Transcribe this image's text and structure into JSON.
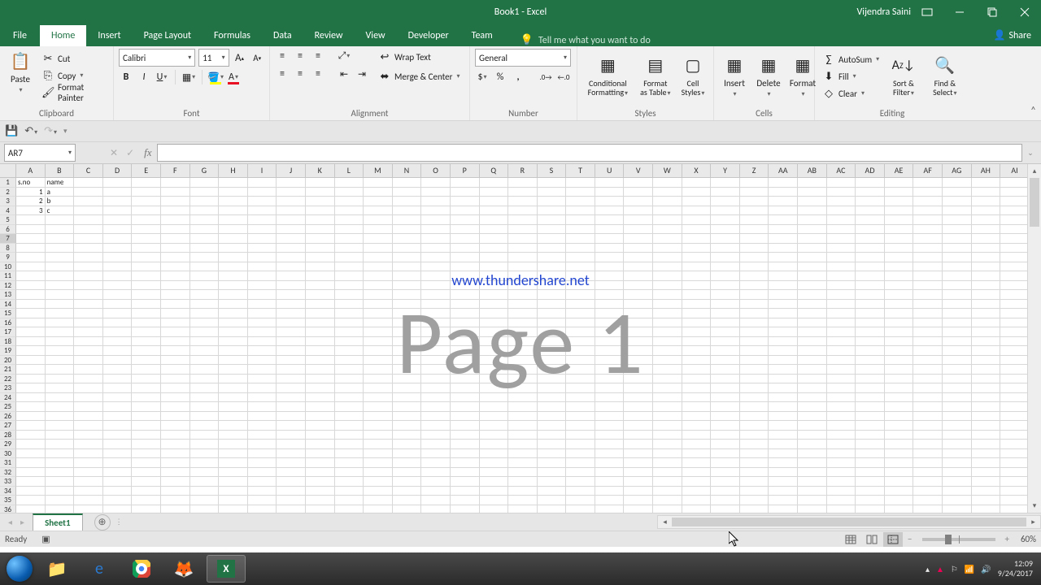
{
  "title": "Book1  -  Excel",
  "user": "Vijendra Saini",
  "tabs": [
    "File",
    "Home",
    "Insert",
    "Page Layout",
    "Formulas",
    "Data",
    "Review",
    "View",
    "Developer",
    "Team"
  ],
  "active_tab": "Home",
  "tellme": "Tell me what you want to do",
  "share": "Share",
  "clipboard": {
    "paste": "Paste",
    "cut": "Cut",
    "copy": "Copy",
    "painter": "Format Painter",
    "label": "Clipboard"
  },
  "font": {
    "name": "Calibri",
    "size": "11",
    "label": "Font"
  },
  "alignment": {
    "wrap": "Wrap Text",
    "merge": "Merge & Center",
    "label": "Alignment"
  },
  "number": {
    "format": "General",
    "label": "Number"
  },
  "styles": {
    "cond": "Conditional Formatting",
    "table": "Format as Table",
    "cell": "Cell Styles",
    "label": "Styles"
  },
  "cells": {
    "insert": "Insert",
    "delete": "Delete",
    "format": "Format",
    "label": "Cells"
  },
  "editing": {
    "autosum": "AutoSum",
    "fill": "Fill",
    "clear": "Clear",
    "sort": "Sort & Filter",
    "find": "Find & Select",
    "label": "Editing"
  },
  "name_box": "AR7",
  "columns": [
    "A",
    "B",
    "C",
    "D",
    "E",
    "F",
    "G",
    "H",
    "I",
    "J",
    "K",
    "L",
    "M",
    "N",
    "O",
    "P",
    "Q",
    "R",
    "S",
    "T",
    "U",
    "V",
    "W",
    "X",
    "Y",
    "Z",
    "AA",
    "AB",
    "AC",
    "AD",
    "AE",
    "AF",
    "AG",
    "AH",
    "AI"
  ],
  "row_count": 36,
  "selected_row": 7,
  "sheet_data": {
    "1": {
      "A": "s.no",
      "B": "name"
    },
    "2": {
      "A": "1",
      "B": "a"
    },
    "3": {
      "A": "2",
      "B": "b"
    },
    "4": {
      "A": "3",
      "B": "c"
    }
  },
  "numeric_cols": [
    "A_from_row2"
  ],
  "watermark_url": "www.thundershare.net",
  "watermark_page": "Page 1",
  "sheet_tab": "Sheet1",
  "status": "Ready",
  "zoom": "60%",
  "clock": {
    "time": "12:09",
    "date": "9/24/2017"
  }
}
